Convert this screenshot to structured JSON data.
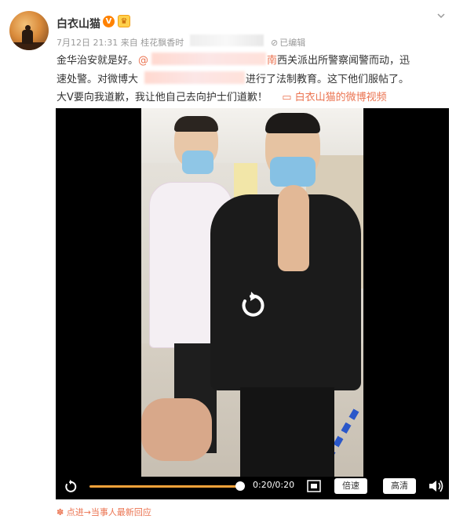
{
  "post": {
    "author": "白衣山猫",
    "v_badge": "V",
    "crown_badge": "♛",
    "meta_date": "7月12日 21:31",
    "meta_from": "来自",
    "meta_device": "桂花飘香时",
    "edited": "已编辑",
    "line1_start": "金华治安就是好。",
    "line1_at": "@",
    "line1_link_end": "南",
    "line1_end": "西关派出所警察闻警而动，迅",
    "line2_start": "速处警。对微博大",
    "line2_end": "进行了法制教育。这下他们服帖了。",
    "line3_start": "大V要向我道歉，我让他自己去向护士们道歉！",
    "line3_video": "白衣山猫的微博视频"
  },
  "video": {
    "time": "0:20/0:20",
    "progress": 1.0,
    "speed_label": "倍速",
    "quality_label": "高清"
  },
  "footer": {
    "icon": "✽",
    "text": "点进→当事人最新回应"
  },
  "colors": {
    "link": "#eb7350",
    "accent": "#ff8200",
    "progress": "#f6a23a"
  }
}
